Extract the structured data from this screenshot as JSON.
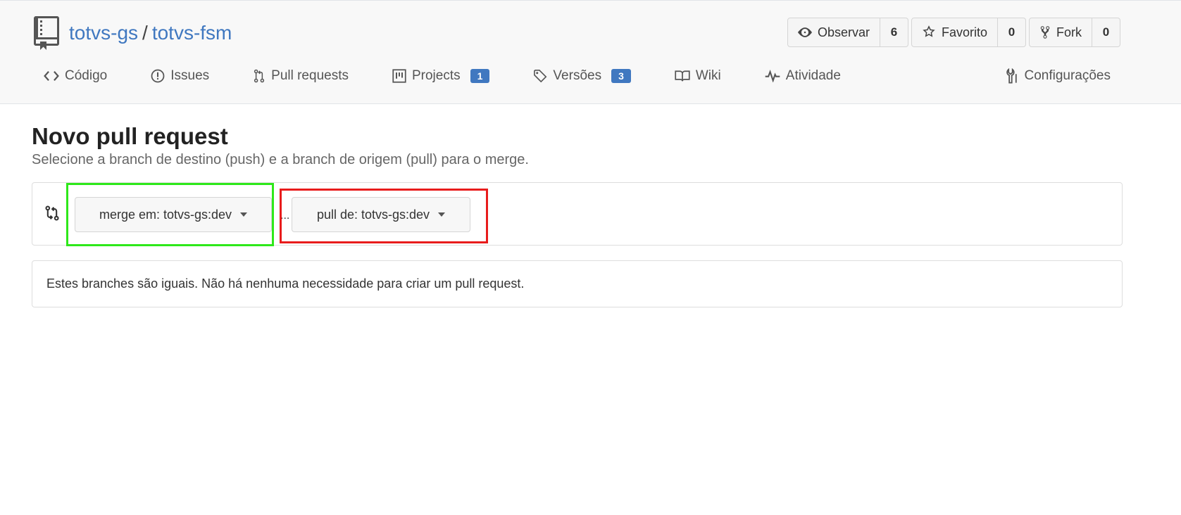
{
  "repo": {
    "owner": "totvs-gs",
    "separator": "/",
    "name": "totvs-fsm"
  },
  "actions": [
    {
      "label": "Observar",
      "count": "6",
      "icon": "eye-icon"
    },
    {
      "label": "Favorito",
      "count": "0",
      "icon": "star-icon"
    },
    {
      "label": "Fork",
      "count": "0",
      "icon": "fork-icon"
    }
  ],
  "nav": {
    "code": "Código",
    "issues": "Issues",
    "pulls": "Pull requests",
    "projects": "Projects",
    "projects_count": "1",
    "releases": "Versões",
    "releases_count": "3",
    "wiki": "Wiki",
    "activity": "Atividade",
    "settings": "Configurações"
  },
  "page": {
    "title": "Novo pull request",
    "subtitle": "Selecione a branch de destino (push) e a branch de origem (pull) para o merge."
  },
  "compare": {
    "base_label": "merge em: totvs-gs:dev",
    "separator": "...",
    "head_label": "pull de: totvs-gs:dev"
  },
  "notice": "Estes branches são iguais. Não há nenhuma necessidade para criar um pull request.",
  "colors": {
    "link": "#4078c0",
    "highlight_base": "#2ee81a",
    "highlight_head": "#e81c1c"
  }
}
